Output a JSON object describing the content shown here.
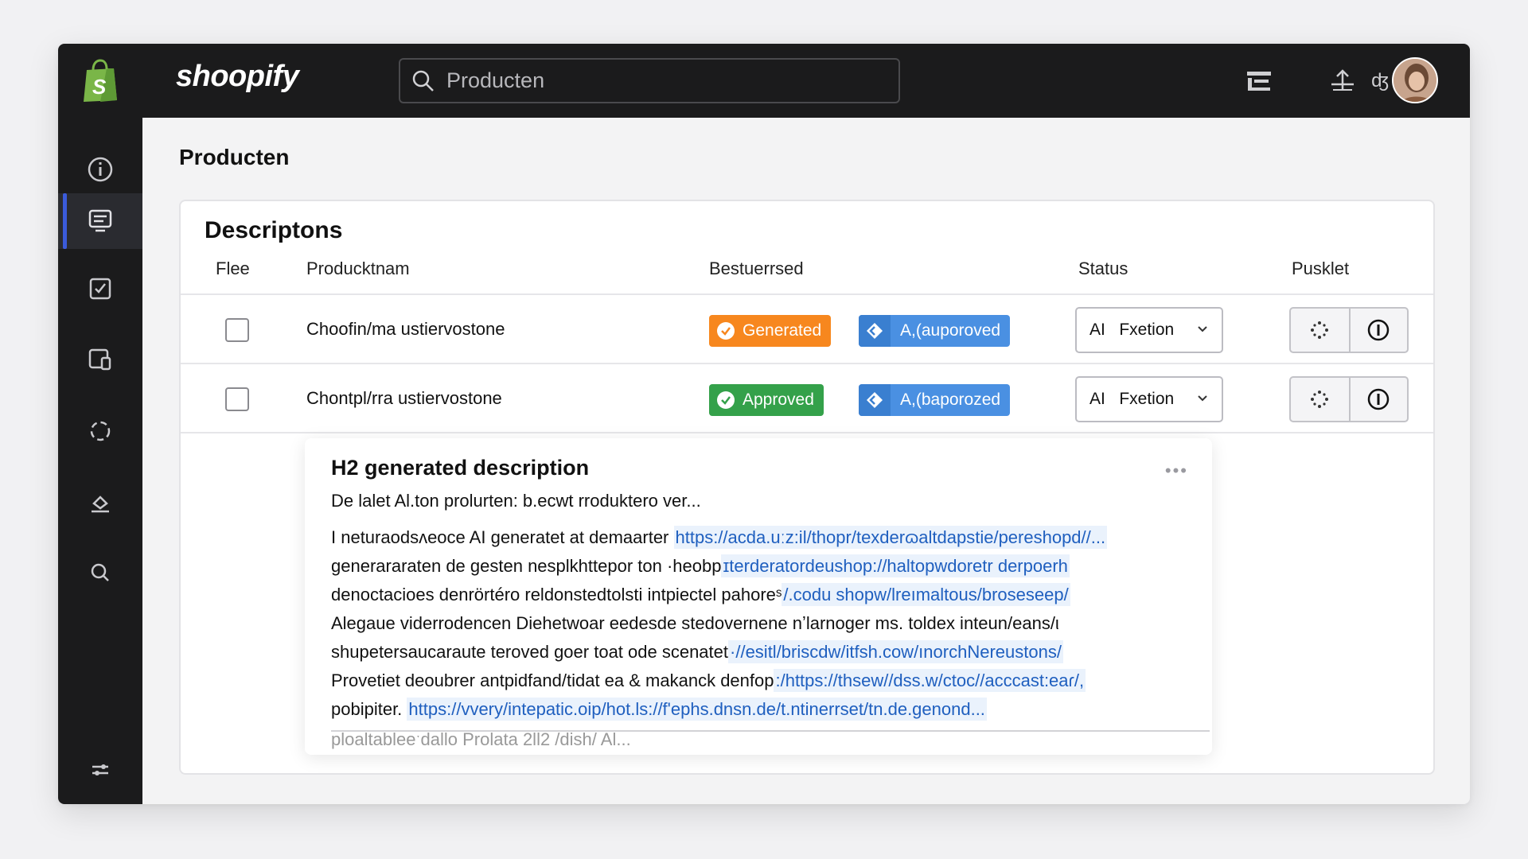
{
  "app": {
    "brand": "shoopify"
  },
  "search": {
    "placeholder": "Producten"
  },
  "sidebar": {
    "items": [
      {
        "name": "info",
        "active": false
      },
      {
        "name": "products",
        "active": true
      },
      {
        "name": "tasks",
        "active": false
      },
      {
        "name": "devices",
        "active": false
      },
      {
        "name": "sync",
        "active": false
      },
      {
        "name": "edit",
        "active": false
      },
      {
        "name": "search",
        "active": false
      },
      {
        "name": "settings",
        "active": false
      }
    ]
  },
  "topbar": {
    "lang_label": "ʤ"
  },
  "page": {
    "title": "Producten"
  },
  "table": {
    "title": "Descriptons",
    "headers": {
      "select": "Flee",
      "name": "Producktnam",
      "managed": "Bestuerrsed",
      "status": "Status",
      "actions": "Pusklet"
    },
    "rows": [
      {
        "name": "Choofin/ma ustiervostone",
        "badge1": {
          "label": "Generated",
          "color": "#f7871e"
        },
        "badge2": {
          "label": "A,(auporoved",
          "color": "#4a90e2"
        },
        "select": "AI   Fxetion"
      },
      {
        "name": "Chontpl/rra ustiervostone",
        "badge1": {
          "label": "Approved",
          "color": "#34a14a"
        },
        "badge2": {
          "label": "A,(baporozed",
          "color": "#4a90e2"
        },
        "select": "AI   Fxetion"
      }
    ]
  },
  "description": {
    "title": "H2 generated description",
    "subtitle": "De lalet Al.ton prolurten: b.ecwt rroduktero ver...",
    "lines": [
      {
        "text": "I neturaodsʌeoce AI generatet at demaarter ",
        "link": "https://acda.uːz:il/thopr/texderɷaltdapstie/pereshopd//..."
      },
      {
        "text": "generararaten de gesten nesplkhttepor ton ·heobp",
        "link": "ɪterderatordeushop://haltopwdoretr derpoerh"
      },
      {
        "text": "denoctacioes denrörtéro reldonstedtolsti intpiectel pahoreˢ",
        "link": "/.codu shopw/lreımaltous/broseseep/"
      },
      {
        "text": "Alegaue viderrodencen Diehetwoar eedesde stedovernene nʼlarnoger ms. toldex inteun/eans/ι",
        "link": ""
      },
      {
        "text": "shupetersaucaraute teroved goer toat ode scenatet",
        "link": "·//esitl/briscdw/itfsh.cow/ınorchNereustons/"
      },
      {
        "text": "Provetiet deoubrer antpidfand/tidat ea & makanck denfop",
        "link": ":/https://thsew//dss.w/ctoc//acccast:eaɾ/,"
      },
      {
        "text": "pobipiter. ",
        "link": "https://vvery/intepatic.oip/hot.ls://f'ephs.dnsn.de/t.ntinerrset/tn.de.genond..."
      }
    ],
    "more": "ploaltableeˑdallo Prolata 2ll2 /dish/ Al..."
  },
  "colors": {
    "accent": "#3b5bdb",
    "topbar": "#1b1b1c",
    "link": "#1f5fbf"
  }
}
